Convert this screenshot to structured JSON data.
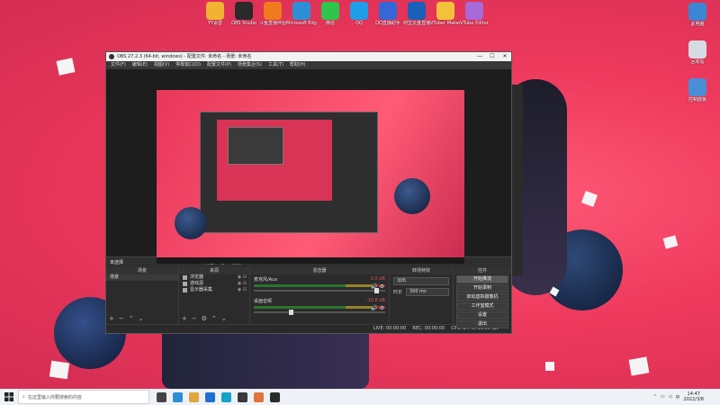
{
  "desktop": {
    "icons_top": [
      {
        "label": "YY语音",
        "color": "#f2b233"
      },
      {
        "label": "OBS Studio",
        "color": "#2a2a2a"
      },
      {
        "label": "斗鱼直播伴侣",
        "color": "#f07b1e"
      },
      {
        "label": "Microsoft Edge",
        "color": "#2c8fd6"
      },
      {
        "label": "微信",
        "color": "#2dc54a"
      },
      {
        "label": "QQ",
        "color": "#1f9ee8"
      },
      {
        "label": "QQ直播助手",
        "color": "#3568d4"
      },
      {
        "label": "阿里云盘直播",
        "color": "#1a5fb8"
      },
      {
        "label": "VTuber Maker",
        "color": "#f3c23a"
      },
      {
        "label": "VTube Editor",
        "color": "#a76ad8"
      }
    ],
    "icons_right": [
      {
        "label": "此电脑",
        "color": "#3a86d4"
      },
      {
        "label": "回收站",
        "color": "#d5dbe3"
      },
      {
        "label": "控制面板",
        "color": "#4a8ed6"
      }
    ]
  },
  "obs": {
    "title": "OBS 27.2.3 (64-bit, windows) - 配置文件: 未命名 - 场景: 未命名",
    "window_controls": [
      "—",
      "☐",
      "✕"
    ],
    "menu": [
      "文件(F)",
      "编辑(E)",
      "视图(V)",
      "停靠窗口(D)",
      "配置文件(P)",
      "场景集合(S)",
      "工具(T)",
      "帮助(H)"
    ],
    "scene_label": "未选择",
    "scene_buttons": [
      "属性",
      "滤镜"
    ],
    "docks": {
      "scenes_title": "场景",
      "sources_title": "来源",
      "mixer_title": "混音器",
      "transitions_title": "转场特效",
      "controls_title": "控件"
    },
    "scenes": [
      "场景"
    ],
    "sources": [
      "浏览器",
      "游戏源",
      "显示器采集"
    ],
    "mixer": [
      {
        "name": "麦克风/Aux",
        "db": "0.0 dB",
        "fader": 0.95
      },
      {
        "name": "桌面音频",
        "db": "-10.8 dB",
        "fader": 0.3
      }
    ],
    "transition": {
      "type": "淡出",
      "duration_label": "时长",
      "duration": "300 ms"
    },
    "controls": [
      "开始推流",
      "开始录制",
      "启动虚拟摄像机",
      "工作室模式",
      "设置",
      "退出"
    ],
    "status": [
      "LIVE: 00:00:00",
      "REC: 00:00:00",
      "CPU: 2.7%, 30.00 fps"
    ]
  },
  "taskbar": {
    "search_placeholder": "在这里输入你要搜索的内容",
    "apps": [
      "#444",
      "#2c8fd6",
      "#e0a73c",
      "#1f6fd1",
      "#16a3c9",
      "#3a3a3a",
      "#e0743b",
      "#2a2a2a"
    ],
    "time": "14:47",
    "date": "2022/3/8",
    "ime": "中"
  }
}
